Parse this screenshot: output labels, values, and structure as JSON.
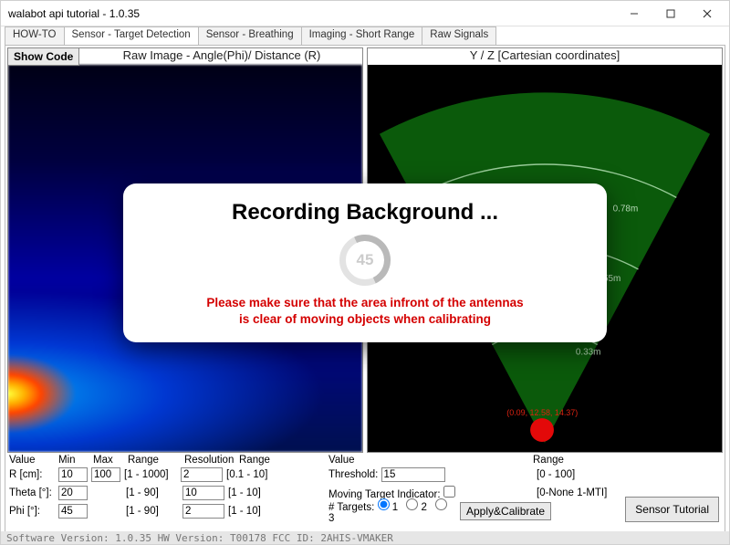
{
  "window": {
    "title": "walabot api tutorial - 1.0.35"
  },
  "tabs": [
    "HOW-TO",
    "Sensor - Target Detection",
    "Sensor - Breathing",
    "Imaging - Short Range",
    "Raw Signals"
  ],
  "active_tab": "Sensor - Target Detection",
  "show_code_label": "Show Code",
  "panes": {
    "left_title": "Raw Image - Angle(Phi)/ Distance (R)",
    "right_title": "Y / Z [Cartesian coordinates]"
  },
  "radar": {
    "rings": [
      "0.78m",
      "0.55m",
      "0.33m"
    ],
    "target_label": "(0.09, 12.58, 14.37)"
  },
  "controls": {
    "headers_left": [
      "Value",
      "Min",
      "Max",
      "Range",
      "Resolution",
      "Range"
    ],
    "rows_left": [
      {
        "label": "R [cm]:",
        "min": "10",
        "max": "100",
        "range": "[1 - 1000]",
        "res": "2",
        "res_range": "[0.1 - 10]"
      },
      {
        "label": "Theta [°]:",
        "min": "20",
        "max": "",
        "range": "[1 - 90]",
        "res": "10",
        "res_range": "[1 - 10]"
      },
      {
        "label": "Phi [°]:",
        "min": "45",
        "max": "",
        "range": "[1 - 90]",
        "res": "2",
        "res_range": "[1 - 10]"
      }
    ],
    "headers_right": [
      "Value",
      "Range"
    ],
    "threshold_label": "Threshold:",
    "threshold_value": "15",
    "threshold_range": "[0 - 100]",
    "mti_label": "Moving Target Indicator:",
    "mti_range": "[0-None 1-MTI]",
    "targets_label": "# Targets:",
    "target_options": [
      "1",
      "2",
      "3"
    ],
    "apply_label": "Apply&Calibrate",
    "sensor_tutorial_label": "Sensor Tutorial"
  },
  "modal": {
    "title": "Recording Background ...",
    "progress": "45",
    "warn_line1": "Please make sure that the area infront of the antennas",
    "warn_line2": "is clear of moving objects when calibrating"
  },
  "status": "Software Version: 1.0.35   HW Version: T00178   FCC ID: 2AHIS-VMAKER"
}
